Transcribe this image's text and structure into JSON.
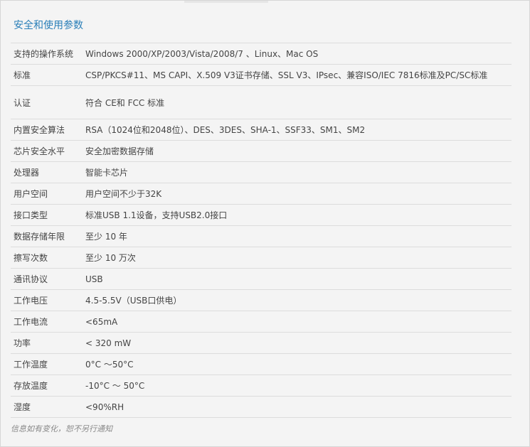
{
  "section": {
    "title": "安全和使用参数"
  },
  "specs": [
    {
      "label": "支持的操作系统",
      "value": "Windows 2000/XP/2003/Vista/2008/7 、Linux、Mac OS"
    },
    {
      "label": "标准",
      "value": "CSP/PKCS#11、MS CAPI、X.509 V3证书存储、SSL V3、IPsec、兼容ISO/IEC 7816标准及PC/SC标准"
    },
    {
      "label": "认证",
      "value": "符合 CE和 FCC 标准"
    },
    {
      "label": "内置安全算法",
      "value": "RSA（1024位和2048位）、DES、3DES、SHA-1、SSF33、SM1、SM2"
    },
    {
      "label": "芯片安全水平",
      "value": "安全加密数据存储"
    },
    {
      "label": "处理器",
      "value": "智能卡芯片"
    },
    {
      "label": "用户空间",
      "value": "用户空间不少于32K"
    },
    {
      "label": "接口类型",
      "value": "标准USB 1.1设备，支持USB2.0接口"
    },
    {
      "label": "数据存储年限",
      "value": "至少 10 年"
    },
    {
      "label": "擦写次数",
      "value": "至少 10 万次"
    },
    {
      "label": "通讯协议",
      "value": "USB"
    },
    {
      "label": "工作电压",
      "value": "4.5-5.5V（USB口供电）"
    },
    {
      "label": "工作电流",
      "value": "<65mA"
    },
    {
      "label": "功率",
      "value": "< 320 mW"
    },
    {
      "label": "工作温度",
      "value": "0°C ～50°C"
    },
    {
      "label": "存放温度",
      "value": "-10°C ～ 50°C"
    },
    {
      "label": "湿度",
      "value": "<90%RH"
    }
  ],
  "footnote": "信息如有变化，恕不另行通知",
  "colors": {
    "title": "#2a7fb8",
    "background": "#f4f4f4",
    "divider": "#dcdcdc",
    "text": "#444444"
  }
}
